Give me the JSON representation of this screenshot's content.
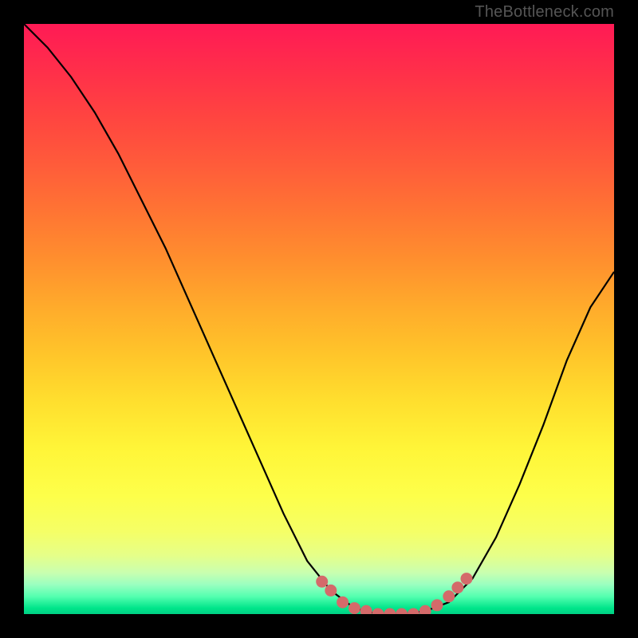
{
  "attribution": "TheBottleneck.com",
  "colors": {
    "background": "#000000",
    "gradient_top": "#ff1a55",
    "gradient_mid": "#ffe83a",
    "gradient_bottom": "#00d084",
    "curve": "#000000",
    "marker": "#d46a6a"
  },
  "chart_data": {
    "type": "line",
    "title": "",
    "xlabel": "",
    "ylabel": "",
    "xlim": [
      0,
      100
    ],
    "ylim": [
      0,
      100
    ],
    "curve_points": [
      {
        "x": 0,
        "y": 100
      },
      {
        "x": 4,
        "y": 96
      },
      {
        "x": 8,
        "y": 91
      },
      {
        "x": 12,
        "y": 85
      },
      {
        "x": 16,
        "y": 78
      },
      {
        "x": 20,
        "y": 70
      },
      {
        "x": 24,
        "y": 62
      },
      {
        "x": 28,
        "y": 53
      },
      {
        "x": 32,
        "y": 44
      },
      {
        "x": 36,
        "y": 35
      },
      {
        "x": 40,
        "y": 26
      },
      {
        "x": 44,
        "y": 17
      },
      {
        "x": 48,
        "y": 9
      },
      {
        "x": 52,
        "y": 4
      },
      {
        "x": 56,
        "y": 1
      },
      {
        "x": 60,
        "y": 0
      },
      {
        "x": 64,
        "y": 0
      },
      {
        "x": 68,
        "y": 0.5
      },
      {
        "x": 72,
        "y": 2
      },
      {
        "x": 76,
        "y": 6
      },
      {
        "x": 80,
        "y": 13
      },
      {
        "x": 84,
        "y": 22
      },
      {
        "x": 88,
        "y": 32
      },
      {
        "x": 92,
        "y": 43
      },
      {
        "x": 96,
        "y": 52
      },
      {
        "x": 100,
        "y": 58
      }
    ],
    "marker_points": [
      {
        "x": 50.5,
        "y": 5.5
      },
      {
        "x": 52,
        "y": 4
      },
      {
        "x": 54,
        "y": 2
      },
      {
        "x": 56,
        "y": 1
      },
      {
        "x": 58,
        "y": 0.5
      },
      {
        "x": 60,
        "y": 0
      },
      {
        "x": 62,
        "y": 0
      },
      {
        "x": 64,
        "y": 0
      },
      {
        "x": 66,
        "y": 0
      },
      {
        "x": 68,
        "y": 0.5
      },
      {
        "x": 70,
        "y": 1.5
      },
      {
        "x": 72,
        "y": 3
      },
      {
        "x": 73.5,
        "y": 4.5
      },
      {
        "x": 75,
        "y": 6
      }
    ]
  }
}
